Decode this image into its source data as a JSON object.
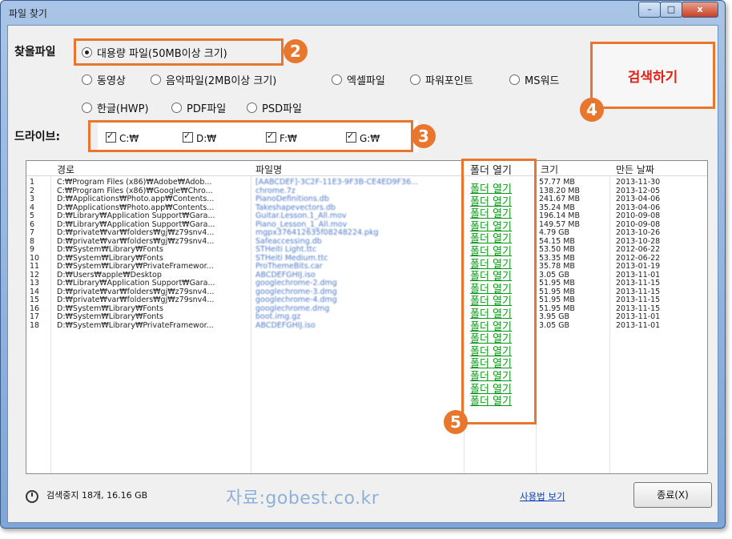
{
  "window": {
    "title": "파일 찾기",
    "min": "–",
    "max": "□",
    "close": "x"
  },
  "search": {
    "label": "찾을파일",
    "options": [
      "대용량 파일(50MB이상 크기)",
      "동영상",
      "음악파일(2MB이상 크기)",
      "엑셀파일",
      "파워포인트",
      "MS워드",
      "한글(HWP)",
      "PDF파일",
      "PSD파일"
    ],
    "selected_index": 0,
    "button": "검색하기"
  },
  "drives": {
    "label": "드라이브:",
    "items": [
      "C:₩",
      "D:₩",
      "F:₩",
      "G:₩"
    ],
    "checked": [
      true,
      true,
      true,
      true
    ]
  },
  "callouts": [
    "2",
    "3",
    "4",
    "5"
  ],
  "table": {
    "columns": [
      "경로",
      "파일명",
      "폴더 열기",
      "크기",
      "만든 날짜"
    ],
    "link_text": "폴더 열기",
    "rows": [
      {
        "n": "1",
        "path": "C:₩Program Files (x86)₩Adobe₩Adob...",
        "name": "[AABCDEF]-3C2F-11E3-9F3B-CE4ED9F36...",
        "size": "57.77 MB",
        "date": "2013-11-30"
      },
      {
        "n": "2",
        "path": "C:₩Program Files (x86)₩Google₩Chro...",
        "name": "chrome.7z",
        "size": "138.20 MB",
        "date": "2013-12-05"
      },
      {
        "n": "3",
        "path": "D:₩Applications₩Photo.app₩Contents...",
        "name": "PianoDefinitions.db",
        "size": "241.67 MB",
        "date": "2013-04-06"
      },
      {
        "n": "4",
        "path": "D:₩Applications₩Photo.app₩Contents...",
        "name": "Takeshapevectors.db",
        "size": "35.24 MB",
        "date": "2013-04-06"
      },
      {
        "n": "5",
        "path": "D:₩Library₩Application Support₩Gara...",
        "name": "Guitar.Lesson.1_All.mov",
        "size": "196.14 MB",
        "date": "2010-09-08"
      },
      {
        "n": "6",
        "path": "D:₩Library₩Application Support₩Gara...",
        "name": "Piano_Lesson_1_All.mov",
        "size": "149.57 MB",
        "date": "2010-09-08"
      },
      {
        "n": "7",
        "path": "D:₩private₩var₩folders₩gj₩z79snv4...",
        "name": "mgpx376412635f08248224.pkg",
        "size": "4.79 GB",
        "date": "2013-10-26"
      },
      {
        "n": "8",
        "path": "D:₩private₩var₩folders₩gj₩z79snv4...",
        "name": "Safeaccessing.db",
        "size": "54.15 MB",
        "date": "2013-10-28"
      },
      {
        "n": "9",
        "path": "D:₩System₩Library₩Fonts",
        "name": "STHeiti Light.ttc",
        "size": "53.50 MB",
        "date": "2012-06-22"
      },
      {
        "n": "10",
        "path": "D:₩System₩Library₩Fonts",
        "name": "STHeiti Medium.ttc",
        "size": "53.35 MB",
        "date": "2012-06-22"
      },
      {
        "n": "11",
        "path": "D:₩System₩Library₩PrivateFramewor...",
        "name": "ProThemeBits.car",
        "size": "35.78 MB",
        "date": "2013-01-19"
      },
      {
        "n": "12",
        "path": "D:₩Users₩apple₩Desktop",
        "name": "ABCDEFGHIJ.iso",
        "size": "3.05 GB",
        "date": "2013-11-01"
      },
      {
        "n": "13",
        "path": "D:₩Library₩Application Support₩Gara...",
        "name": "googlechrome-2.dmg",
        "size": "51.95 MB",
        "date": "2013-11-15"
      },
      {
        "n": "14",
        "path": "D:₩private₩var₩folders₩gj₩z79snv4...",
        "name": "googlechrome-3.dmg",
        "size": "51.95 MB",
        "date": "2013-11-15"
      },
      {
        "n": "15",
        "path": "D:₩private₩var₩folders₩gj₩z79snv4...",
        "name": "googlechrome-4.dmg",
        "size": "51.95 MB",
        "date": "2013-11-15"
      },
      {
        "n": "16",
        "path": "D:₩System₩Library₩Fonts",
        "name": "googlechrome.dmg",
        "size": "51.95 MB",
        "date": "2013-11-15"
      },
      {
        "n": "17",
        "path": "D:₩System₩Library₩Fonts",
        "name": "boot.img.gz",
        "size": "3.95 GB",
        "date": "2013-11-01"
      },
      {
        "n": "18",
        "path": "D:₩System₩Library₩PrivateFramewor...",
        "name": "ABCDEFGHIJ.iso",
        "size": "3.05 GB",
        "date": "2013-11-01"
      }
    ]
  },
  "status": {
    "text": "검색중지 18개, 16.16 GB"
  },
  "watermark": "자료:gobest.co.kr",
  "usage_link": "사용법 보기",
  "end_button": "종료(X)"
}
